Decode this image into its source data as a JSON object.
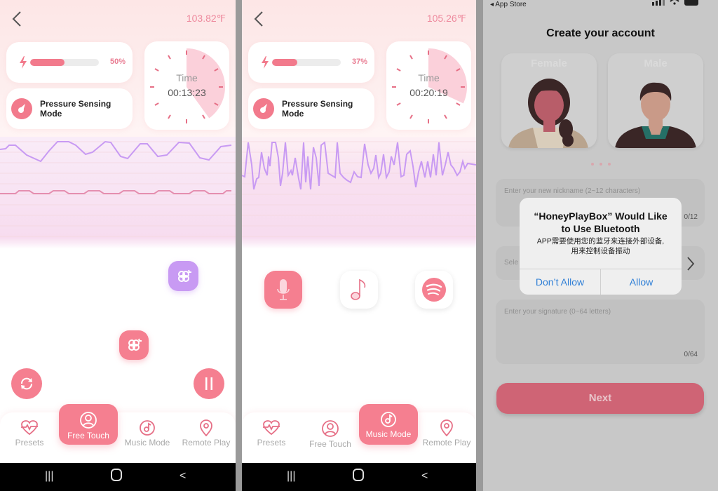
{
  "panels": [
    {
      "temperature": "103.82℉",
      "battery": {
        "percent_label": "50%",
        "fraction": 0.5
      },
      "mode": {
        "label": "Pressure Sensing Mode",
        "line1": "Pressure Sensing",
        "line2": "Mode"
      },
      "timer": {
        "label": "Time",
        "value": "00:13:23",
        "fraction": 0.4
      },
      "nav": [
        {
          "label": "Presets",
          "icon": "heart-pulse-icon"
        },
        {
          "label": "Free Touch",
          "icon": "user-circle-icon",
          "active": true
        },
        {
          "label": "Music Mode",
          "icon": "music-disc-icon"
        },
        {
          "label": "Remote Play",
          "icon": "location-pin-icon"
        }
      ]
    },
    {
      "temperature": "105.26℉",
      "battery": {
        "percent_label": "37%",
        "fraction": 0.37
      },
      "mode": {
        "label": "Pressure Sensing Mode",
        "line1": "Pressure Sensing",
        "line2": "Mode"
      },
      "timer": {
        "label": "Time",
        "value": "00:20:19",
        "fraction": 0.32
      },
      "music_sources": [
        {
          "name": "microphone",
          "icon": "microphone-icon",
          "active": true
        },
        {
          "name": "music",
          "icon": "music-note-icon"
        },
        {
          "name": "spotify",
          "icon": "spotify-icon"
        }
      ],
      "nav": [
        {
          "label": "Presets",
          "icon": "heart-pulse-icon"
        },
        {
          "label": "Free Touch",
          "icon": "user-circle-icon"
        },
        {
          "label": "Music Mode",
          "icon": "music-disc-icon",
          "active": true
        },
        {
          "label": "Remote Play",
          "icon": "location-pin-icon"
        }
      ]
    },
    {
      "status_back": "◂ App Store",
      "title": "Create your account",
      "genders": [
        "Female",
        "Male"
      ],
      "nickname_placeholder": "Enter your new nickname (2~12 characters)",
      "nickname_count": "0/12",
      "select_placeholder": "Sele",
      "signature_placeholder": "Enter your signature (0~64 letters)",
      "signature_count": "0/64",
      "next_label": "Next",
      "alert": {
        "title_line1": "“HoneyPlayBox” Would Like",
        "title_line2": "to Use Bluetooth",
        "message_line1": "APP需要使用您的蓝牙来连接外部设备,",
        "message_line2": "用来控制设备振动",
        "deny_label": "Don’t Allow",
        "allow_label": "Allow"
      }
    }
  ],
  "colors": {
    "accent": "#f57f90",
    "purple": "#c89af3",
    "alert_button": "#2f7fd6"
  }
}
